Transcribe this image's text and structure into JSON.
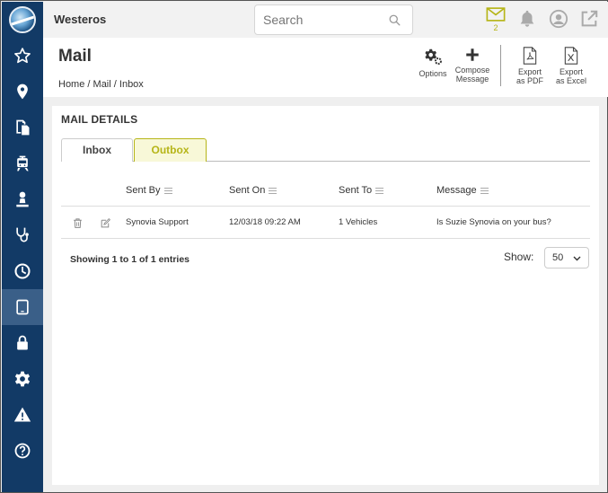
{
  "app": {
    "brand": "Westeros"
  },
  "search": {
    "placeholder": "Search"
  },
  "notifications": {
    "mail_count": "2"
  },
  "header": {
    "title": "Mail",
    "breadcrumb": [
      {
        "label": "Home"
      },
      {
        "label": "Mail"
      },
      {
        "label": "Inbox"
      }
    ],
    "breadcrumb_sep": "/"
  },
  "toolbar": {
    "options": "Options",
    "compose_line1": "Compose",
    "compose_line2": "Message",
    "pdf_line1": "Export",
    "pdf_line2": "as PDF",
    "excel_line1": "Export",
    "excel_line2": "as Excel"
  },
  "sidebar": {
    "items": [
      {
        "icon": "star-icon"
      },
      {
        "icon": "map-pin-icon"
      },
      {
        "icon": "documents-icon"
      },
      {
        "icon": "bus-icon"
      },
      {
        "icon": "driver-icon"
      },
      {
        "icon": "stethoscope-icon"
      },
      {
        "icon": "clock-icon"
      },
      {
        "icon": "tablet-icon",
        "active": true
      },
      {
        "icon": "lock-icon"
      },
      {
        "icon": "gear-icon"
      },
      {
        "icon": "warning-icon"
      },
      {
        "icon": "help-icon"
      }
    ]
  },
  "panel": {
    "title": "MAIL DETAILS",
    "tabs": [
      {
        "label": "Inbox"
      },
      {
        "label": "Outbox",
        "active": true
      }
    ]
  },
  "table": {
    "columns": [
      "Sent By",
      "Sent On",
      "Sent To",
      "Message"
    ],
    "rows": [
      {
        "sent_by": "Synovia Support",
        "sent_on": "12/03/18 09:22 AM",
        "sent_to": "1 Vehicles",
        "message": "Is Suzie Synovia on your bus?"
      }
    ]
  },
  "footer": {
    "info": "Showing 1 to 1 of 1 entries",
    "show_label": "Show:",
    "show_value": "50"
  },
  "colors": {
    "sidebar": "#123a66",
    "sidebar_active": "#3a5f88",
    "accent": "#b6b518"
  }
}
